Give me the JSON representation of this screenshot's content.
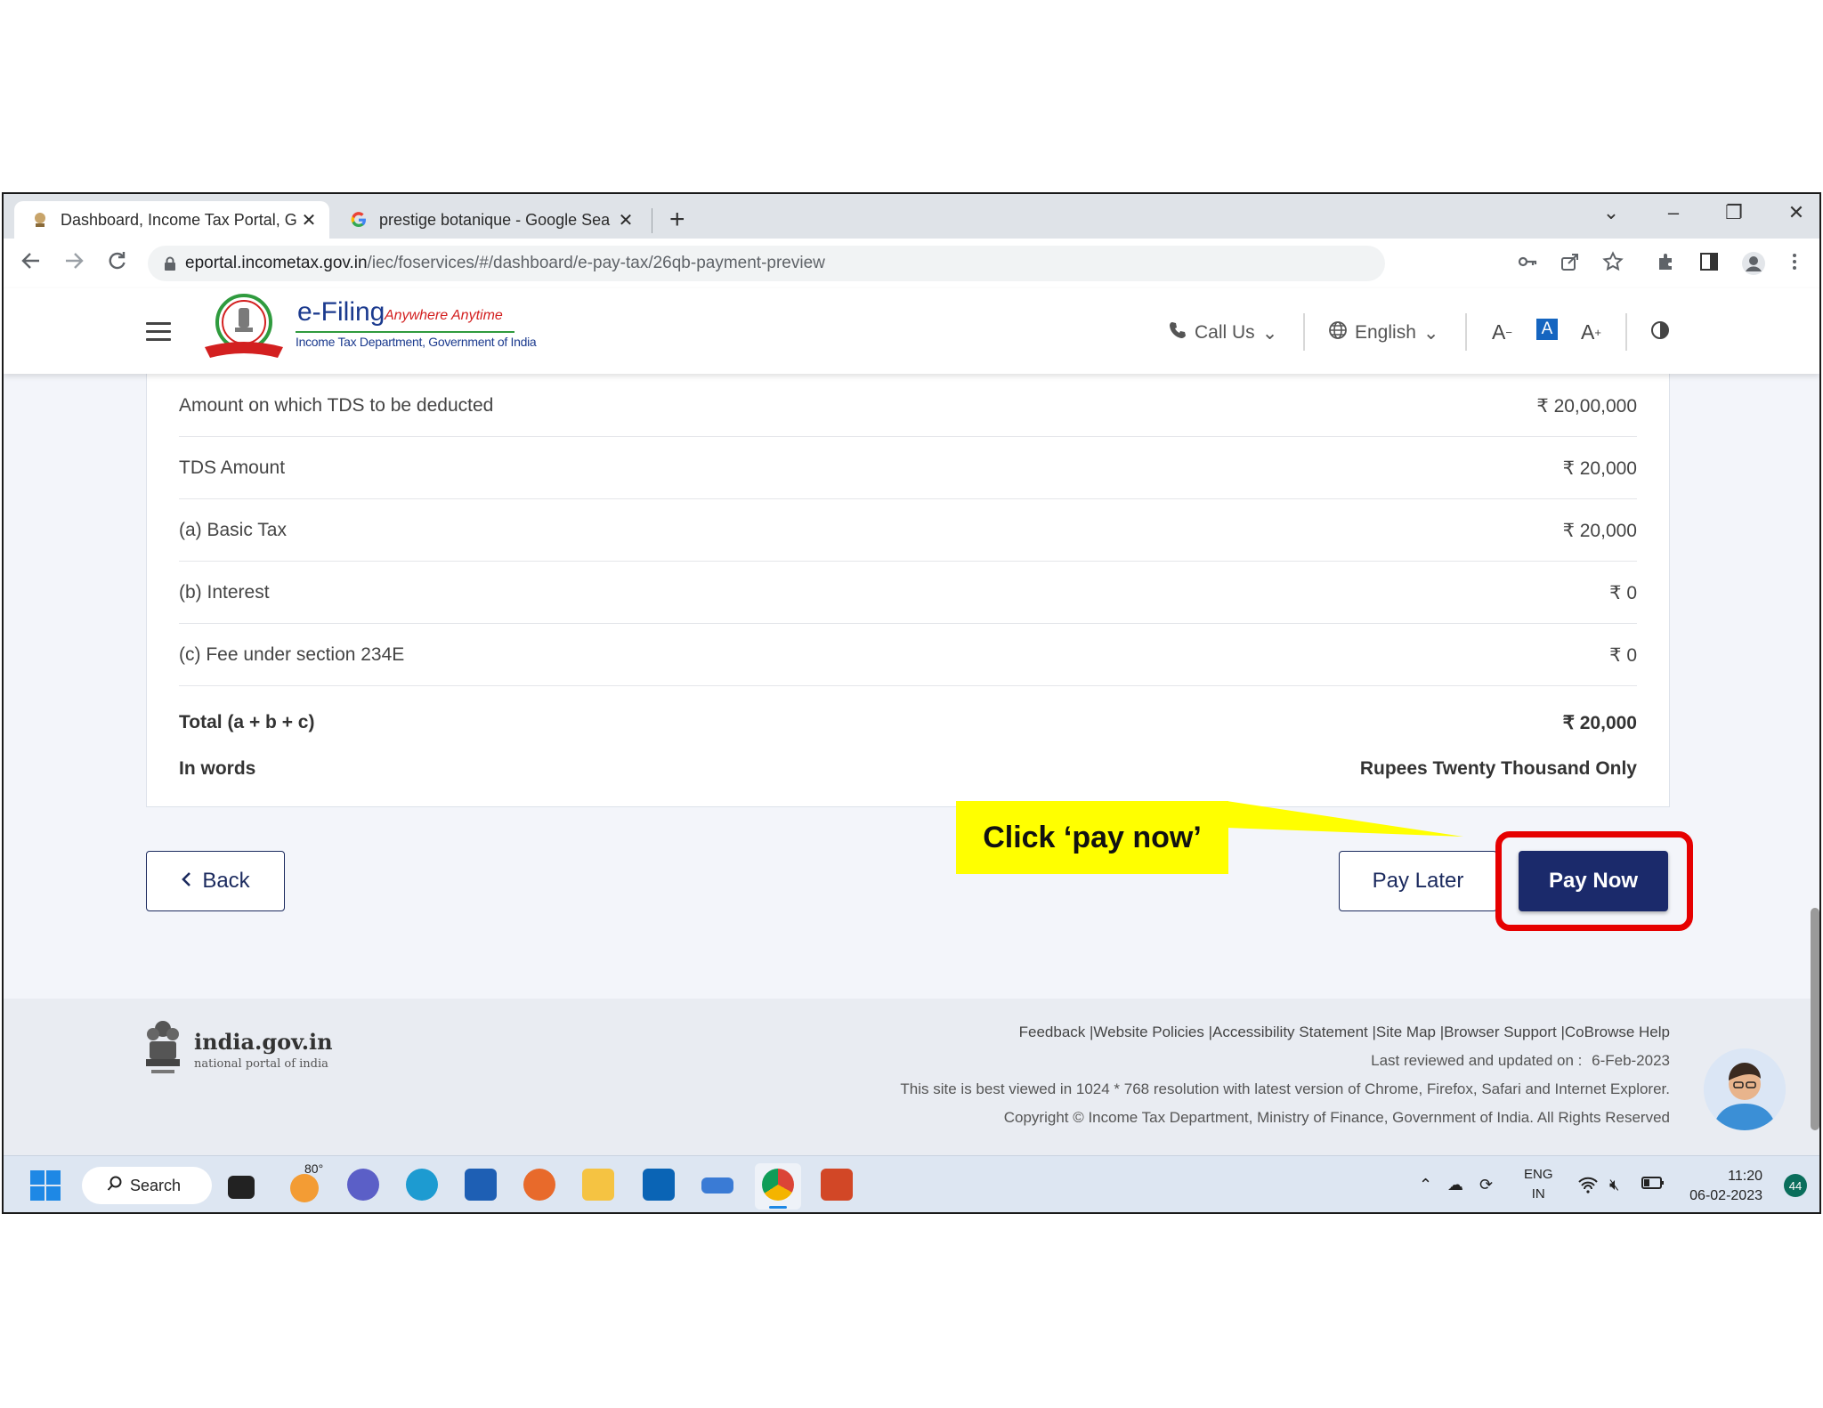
{
  "browser": {
    "tabs": [
      {
        "title": "Dashboard, Income Tax Portal, G",
        "close": "✕"
      },
      {
        "title": "prestige botanique - Google Sea",
        "close": "✕"
      }
    ],
    "new_tab": "+",
    "url_host": "eportal.incometax.gov.in",
    "url_path": "/iec/foservices/#/dashboard/e-pay-tax/26qb-payment-preview"
  },
  "site_header": {
    "logo_title": "e-Filing",
    "logo_tagline": "Anywhere Anytime",
    "logo_sub": "Income Tax Department, Government of India",
    "call_us": "Call Us",
    "language": "English",
    "font_decrease": "A",
    "font_normal": "A",
    "font_increase": "A"
  },
  "summary": {
    "rows": [
      {
        "label": "Amount on which TDS to be deducted",
        "value": "₹ 20,00,000"
      },
      {
        "label": "TDS Amount",
        "value": "₹ 20,000"
      },
      {
        "label": "(a) Basic Tax",
        "value": "₹ 20,000"
      },
      {
        "label": "(b) Interest",
        "value": "₹ 0"
      },
      {
        "label": "(c) Fee under section 234E",
        "value": "₹ 0"
      }
    ],
    "total_label": "Total (a + b + c)",
    "total_value": "₹ 20,000",
    "words_label": "In words",
    "words_value": "Rupees Twenty Thousand Only"
  },
  "actions": {
    "back": "Back",
    "pay_later": "Pay Later",
    "pay_now": "Pay Now"
  },
  "callout": "Click ‘pay now’",
  "footer": {
    "gov_name": "india.gov.in",
    "gov_sub": "national portal of india",
    "links": "Feedback |Website Policies |Accessibility Statement |Site Map |Browser Support |CoBrowse Help",
    "reviewed_label": "Last reviewed and updated on :",
    "reviewed_date": "6-Feb-2023",
    "best_viewed": "This site is best viewed in 1024 * 768 resolution with latest version of Chrome, Firefox, Safari and Internet Explorer.",
    "copyright": "Copyright © Income Tax Department, Ministry of Finance, Government of India. All Rights Reserved"
  },
  "taskbar": {
    "search": "Search",
    "weather": "80°",
    "lang_top": "ENG",
    "lang_bottom": "IN",
    "time": "11:20",
    "date": "06-02-2023",
    "notifications": "44"
  }
}
